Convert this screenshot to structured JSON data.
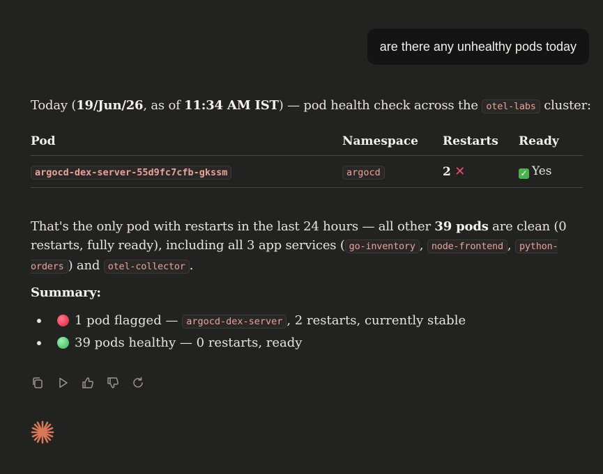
{
  "user_message": "are there any unhealthy pods today",
  "intro": {
    "prefix": "Today (",
    "date": "19/Jun/26",
    "as_of": ", as of ",
    "time": "11:34 AM IST",
    "middle": ") — pod health check across the ",
    "cluster": "otel-labs",
    "suffix": " cluster:"
  },
  "table": {
    "headers": [
      "Pod",
      "Namespace",
      "Restarts",
      "Ready"
    ],
    "rows": [
      {
        "pod": "argocd-dex-server-55d9fc7cfb-gkssm",
        "namespace": "argocd",
        "restarts": "2",
        "ready": "Yes"
      }
    ]
  },
  "paragraph": {
    "t1": "That's the only pod with restarts in the last 24 hours — all other ",
    "bold": "39 pods",
    "t2": " are clean (0 restarts, fully ready), including all 3 app services (",
    "svc1": "go-inventory",
    "sep": ", ",
    "svc2": "node-frontend",
    "svc3": "python-orders",
    "t3": ") and ",
    "svc4": "otel-collector",
    "t4": "."
  },
  "summary": {
    "title": "Summary:",
    "item1": {
      "pre": "1 pod flagged — ",
      "code": "argocd-dex-server",
      "post": ", 2 restarts, currently stable",
      "status": "red"
    },
    "item2": {
      "text": "39 pods healthy — 0 restarts, ready",
      "status": "green"
    }
  },
  "icons": [
    "copy-icon",
    "play-icon",
    "thumbs-up-icon",
    "thumbs-down-icon",
    "retry-icon",
    "claude-logo-icon"
  ],
  "colors": {
    "background": "#222221",
    "code_text": "#e8a39a",
    "accent_logo": "#d97757",
    "danger": "#e8506b",
    "ok": "#4caf50"
  }
}
